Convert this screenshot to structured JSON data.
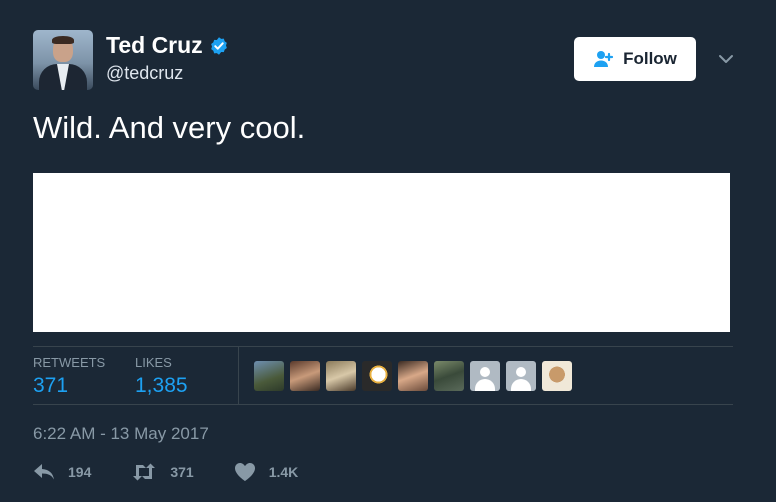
{
  "user": {
    "display_name": "Ted Cruz",
    "handle": "@tedcruz",
    "verified": true
  },
  "follow_button": {
    "label": "Follow"
  },
  "tweet": {
    "text": "Wild. And very cool.",
    "timestamp": "6:22 AM - 13 May 2017"
  },
  "stats": {
    "retweets_label": "RETWEETS",
    "retweets_value": "371",
    "likes_label": "LIKES",
    "likes_value": "1,385"
  },
  "actions": {
    "reply_count": "194",
    "retweet_count": "371",
    "like_count": "1.4K"
  },
  "colors": {
    "background": "#1b2836",
    "accent": "#1da1f2",
    "muted": "#8899a6"
  },
  "icons": [
    "verified-badge-icon",
    "follow-person-icon",
    "chevron-down-icon",
    "reply-icon",
    "retweet-icon",
    "heart-icon"
  ]
}
